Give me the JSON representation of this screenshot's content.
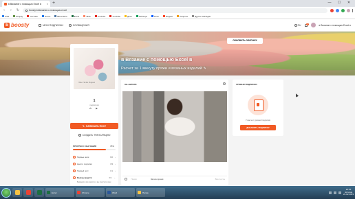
{
  "browser": {
    "tab_title": "в Вязание с помощью Excel в",
    "tab_close": "×",
    "new_tab": "+",
    "url": "boosty.to/вязание-с-помощью-excel",
    "win_controls": [
      "—",
      "☐",
      "✕"
    ],
    "nav_back": "‹",
    "nav_forward": "›",
    "nav_reload": "↻",
    "bookmarks": [
      {
        "label": "CSS",
        "color": "#2b7de9"
      },
      {
        "label": "Shopify",
        "color": "#5e8e3e"
      },
      {
        "label": "YouTube",
        "color": "#e62117"
      },
      {
        "label": "Почта",
        "color": "#1a73e8"
      },
      {
        "label": "ВКонтакте",
        "color": "#4c75a3"
      },
      {
        "label": "Excel",
        "color": "#1d6f42"
      },
      {
        "label": "Tilda",
        "color": "#ff8562"
      },
      {
        "label": "YouTube",
        "color": "#e62117"
      },
      {
        "label": "YouTube",
        "color": "#e62117"
      },
      {
        "label": "Диск",
        "color": "#fbbc04"
      },
      {
        "label": "Таблицы",
        "color": "#0f9d58"
      },
      {
        "label": "Ozon",
        "color": "#005bff"
      },
      {
        "label": "Яндекс",
        "color": "#fc3f1d"
      },
      {
        "label": "Рецепты",
        "color": "#f29900"
      },
      {
        "label": "Другие закладки",
        "color": "#888888"
      }
    ]
  },
  "header": {
    "logo_text": "boosty",
    "logo_mark": "b",
    "nav": [
      {
        "label": "МОИ ПОДПИСКИ"
      },
      {
        "label": "СООБЩЕНИЯ"
      }
    ],
    "lang": "RU",
    "bell_badge": "1",
    "user_name": "в Вязание с помощью Excel в"
  },
  "cover": {
    "update_button": "ОБНОВИТЬ ОБЛОЖКУ",
    "title": "в Вязание с помощью Excel в",
    "subtitle": "Расчет за 1 минуту пряжи и вязаных изделий",
    "edit_icon": "✎"
  },
  "profile": {
    "avatar_caption": "The Silk Paper",
    "subscribers_count": "1",
    "subscribers_label": "подписчик",
    "socials": [
      "vk-icon",
      "youtube-icon"
    ],
    "social_glyphs": [
      "vk",
      "▶"
    ],
    "write_post": "НАПИСАТЬ ПОСТ",
    "write_post_icon": "✎",
    "create_broadcast": "СОЗДАТЬ ТРАНСЛЯЦИЮ"
  },
  "progress": {
    "title": "ПРОГРЕСС ОБУЧЕНИЯ",
    "percent_label": "78%",
    "percent_value": 0.78,
    "steps": [
      {
        "label": "Первые шаги",
        "count": "6/6",
        "done": true
      },
      {
        "label": "Цели и подписки",
        "count": "3/3",
        "done": true
      },
      {
        "label": "Первый пост",
        "count": "1/1",
        "done": true
      },
      {
        "label": "Вывод средств",
        "count": "0/1",
        "done": false
      }
    ],
    "note": "Выведите все вместе и вы получите ваш"
  },
  "about": {
    "title": "ОБ АВТОРЕ",
    "info_icon": "i"
  },
  "feed_bar": {
    "search_placeholder": "Поиск",
    "sort_label": "За все время",
    "filter_label": "Все посты"
  },
  "levels": {
    "title": "УРОВНИ ПОДПИСКИ",
    "empty_text": "У вас нет уровней подписки",
    "add_button": "ДОБАВИТЬ ПОДПИСКУ"
  },
  "taskbar": {
    "icons": [
      {
        "name": "explorer",
        "color": "#f6c445"
      },
      {
        "name": "chrome",
        "color": "#e94235"
      },
      {
        "name": "excel",
        "color": "#1d6f42"
      }
    ],
    "tasks": [
      {
        "label": "Excel",
        "color": "#1d6f42"
      },
      {
        "label": "Chrome",
        "color": "#e94235"
      },
      {
        "label": "Word",
        "color": "#2b579a"
      },
      {
        "label": "Папка",
        "color": "#f6c445"
      }
    ],
    "clock_time": "20:45",
    "clock_day": "пятница",
    "clock_date": "24.02.2023"
  },
  "colors": {
    "accent": "#f15a24",
    "taskbar": "#2f526c"
  }
}
